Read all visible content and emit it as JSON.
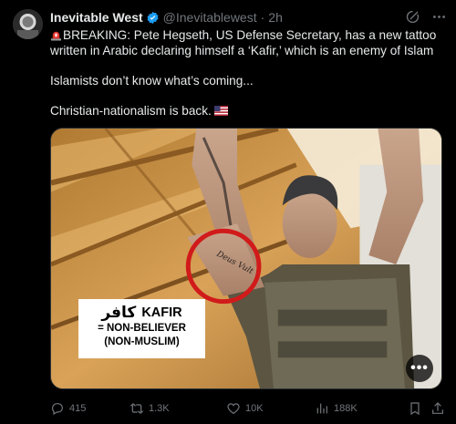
{
  "author": {
    "name": "Inevitable West",
    "handle": "@Inevitablewest",
    "separator": "·",
    "time": "2h"
  },
  "tweet": {
    "line1": "BREAKING: Pete Hegseth, US Defense Secretary, has a new tattoo written in Arabic declaring himself a ‘Kafir,’ which is an enemy of Islam",
    "line2": "Islamists don’t know what’s coming...",
    "line3": "Christian-nationalism is back."
  },
  "image_overlay": {
    "arabic": "كافر",
    "word": "KAFIR",
    "meaning_line1": "= NON-BELIEVER",
    "meaning_line2": "(NON-MUSLIM)",
    "more_label": "•••"
  },
  "stats": {
    "replies": "415",
    "reposts": "1.3K",
    "likes": "10K",
    "views": "188K"
  },
  "icons": {
    "verified": "verified-badge-icon",
    "grok": "grok-icon",
    "more": "more-icon",
    "siren": "siren-emoji-icon",
    "flag": "us-flag-emoji-icon",
    "reply": "reply-icon",
    "repost": "repost-icon",
    "like": "heart-icon",
    "views": "views-icon",
    "bookmark": "bookmark-icon",
    "share": "share-icon"
  },
  "colors": {
    "background": "#000000",
    "text": "#e7e9ea",
    "muted": "#71767b",
    "verified": "#1d9bf0",
    "highlight_circle": "#d11a1a"
  }
}
